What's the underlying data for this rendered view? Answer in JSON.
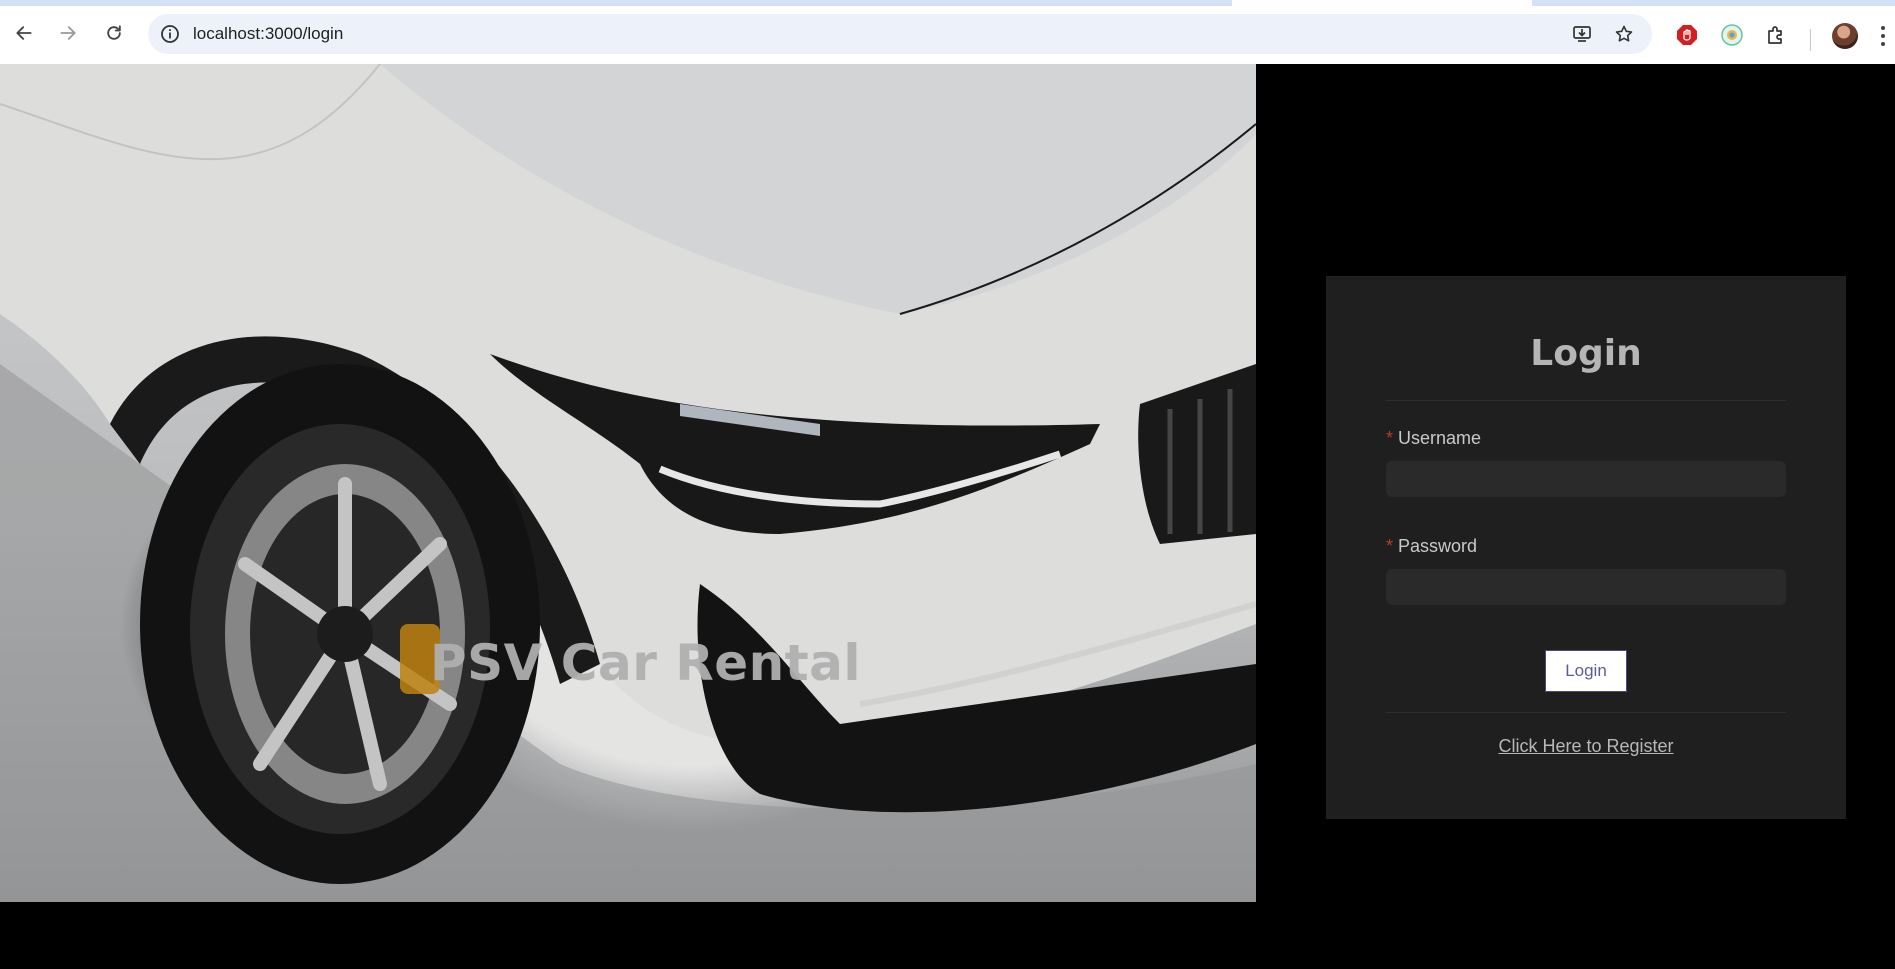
{
  "browser": {
    "url": "localhost:3000/login",
    "icons": {
      "back": "back-arrow-icon",
      "forward": "forward-arrow-icon",
      "reload": "reload-icon",
      "site_info": "site-info-icon",
      "install": "install-app-icon",
      "bookmark": "bookmark-star-icon",
      "extension_1": "adblock-icon",
      "extension_2": "extension-icon",
      "extensions": "puzzle-extensions-icon",
      "profile": "profile-avatar",
      "menu": "kebab-menu-icon"
    }
  },
  "hero": {
    "title": "PSV Car Rental"
  },
  "login": {
    "title": "Login",
    "username_label": "Username",
    "username_value": "",
    "password_label": "Password",
    "password_value": "",
    "required_mark": "*",
    "submit_label": "Login",
    "register_link": "Click Here to Register"
  },
  "colors": {
    "page_bg": "#000000",
    "card_bg": "#1f1f1f",
    "input_bg": "#2a2a2a",
    "required": "#c0392b",
    "button_text": "#5c5c9a"
  }
}
